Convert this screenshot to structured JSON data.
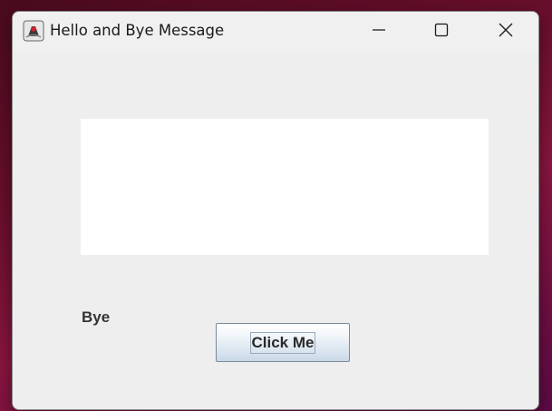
{
  "window": {
    "title": "Hello and Bye Message",
    "controls": {
      "minimize": "minimize-icon",
      "maximize": "maximize-icon",
      "close": "close-icon"
    },
    "app_icon": "java-duke-icon"
  },
  "content": {
    "message_label": "Bye",
    "button_label": "Click Me"
  },
  "colors": {
    "window_bg": "#eeeeee",
    "panel_bg": "#ffffff",
    "desktop_accent": "#8a1540"
  }
}
